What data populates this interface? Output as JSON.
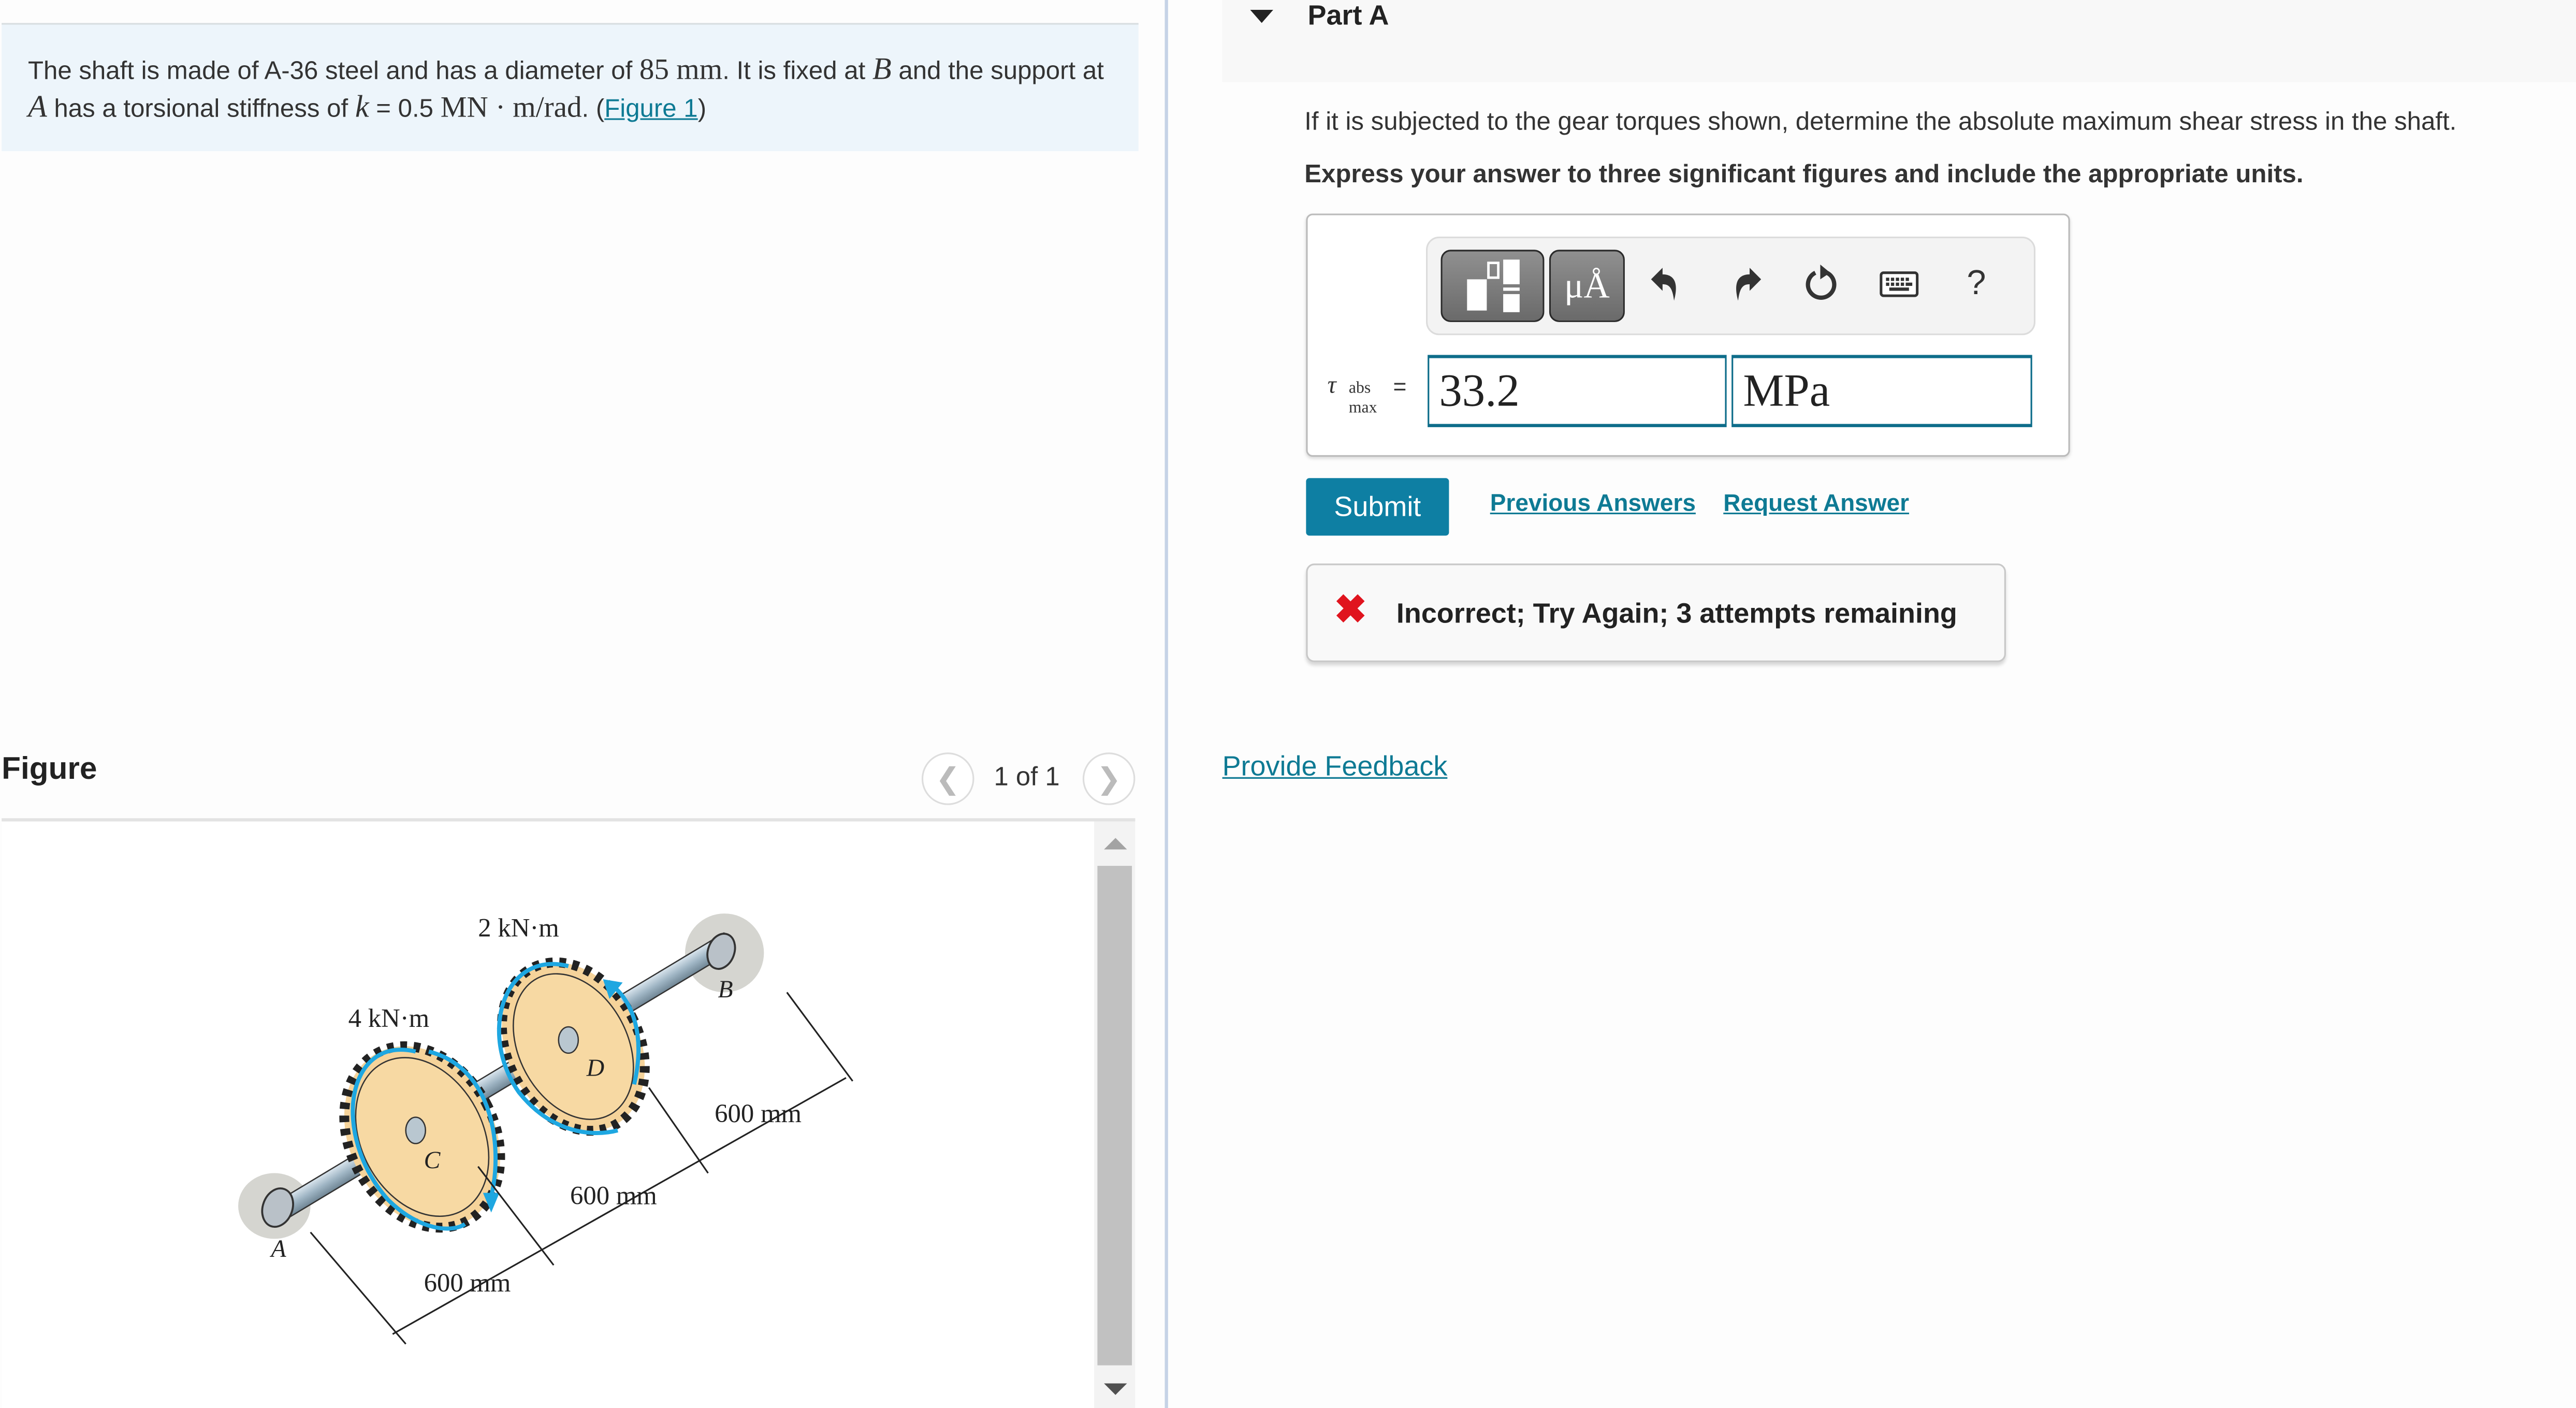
{
  "problem": {
    "text_1": "The shaft is made of A-36 steel and has a diameter of ",
    "diameter": "85 mm",
    "text_2": ". It is fixed at ",
    "fixed_point": "B",
    "text_3": " and the support at ",
    "support_point": "A",
    "text_4": " has a torsional stiffness of ",
    "k_symbol": "k",
    "k_eq": " = 0.5 ",
    "k_units": "MN · m/rad",
    "text_5": ". (",
    "figure_link": "Figure 1",
    "text_6": ")"
  },
  "figure_panel": {
    "title": "Figure",
    "page_indicator": "1 of 1",
    "prev_icon": "chevron-left-icon",
    "next_icon": "chevron-right-icon",
    "diagram": {
      "torque_C": "4 kN·m",
      "torque_D": "2 kN·m",
      "point_A": "A",
      "point_B": "B",
      "point_C": "C",
      "point_D": "D",
      "dim_AC": "600 mm",
      "dim_CD": "600 mm",
      "dim_DB": "600 mm"
    }
  },
  "part": {
    "title": "Part A",
    "question": "If it is subjected to the gear torques shown, determine the absolute maximum shear stress in the shaft.",
    "instruction": "Express your answer to three significant figures and include the appropriate units.",
    "toolbar": {
      "templates_icon": "templates-icon",
      "units_label": "μÅ",
      "undo_icon": "undo-icon",
      "redo_icon": "redo-icon",
      "reset_icon": "reset-icon",
      "keyboard_icon": "keyboard-icon",
      "help_label": "?"
    },
    "answer": {
      "symbol": "τ",
      "sup": "abs",
      "sub": "max",
      "equals": "=",
      "value": "33.2",
      "unit": "MPa"
    },
    "submit_label": "Submit",
    "previous_answers_label": "Previous Answers",
    "request_answer_label": "Request Answer",
    "feedback": {
      "icon": "✖",
      "text": "Incorrect; Try Again; 3 attempts remaining",
      "color": "#e0141e"
    }
  },
  "provide_feedback_label": "Provide Feedback",
  "colors": {
    "accent": "#0e7fa3",
    "link": "#0e7a94",
    "problem_bg": "#edf5fb"
  }
}
